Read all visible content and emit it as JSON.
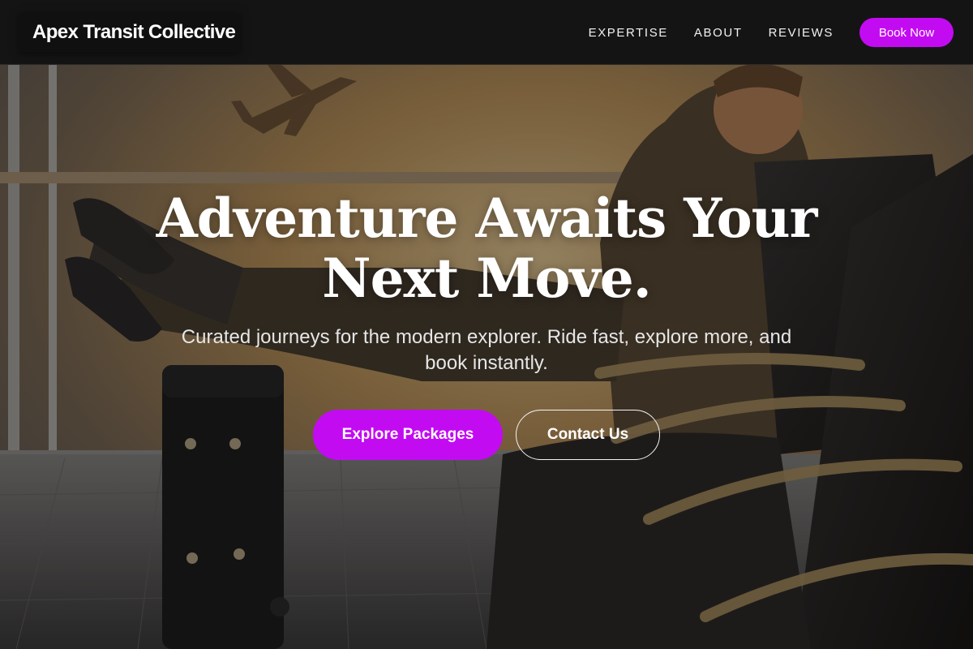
{
  "nav": {
    "brand": "Apex Transit Collective",
    "links": [
      "EXPERTISE",
      "ABOUT",
      "REVIEWS"
    ],
    "cta": "Book Now"
  },
  "hero": {
    "headline_line1": "Adventure Awaits Your",
    "headline_line2": "Next Move.",
    "subtitle": "Curated journeys for the modern explorer. Ride fast, explore more, and book instantly.",
    "primary_button": "Explore Packages",
    "secondary_button": "Contact Us"
  },
  "colors": {
    "accent": "#c30bf2",
    "nav_background": "#151414",
    "text": "#ffffff"
  }
}
